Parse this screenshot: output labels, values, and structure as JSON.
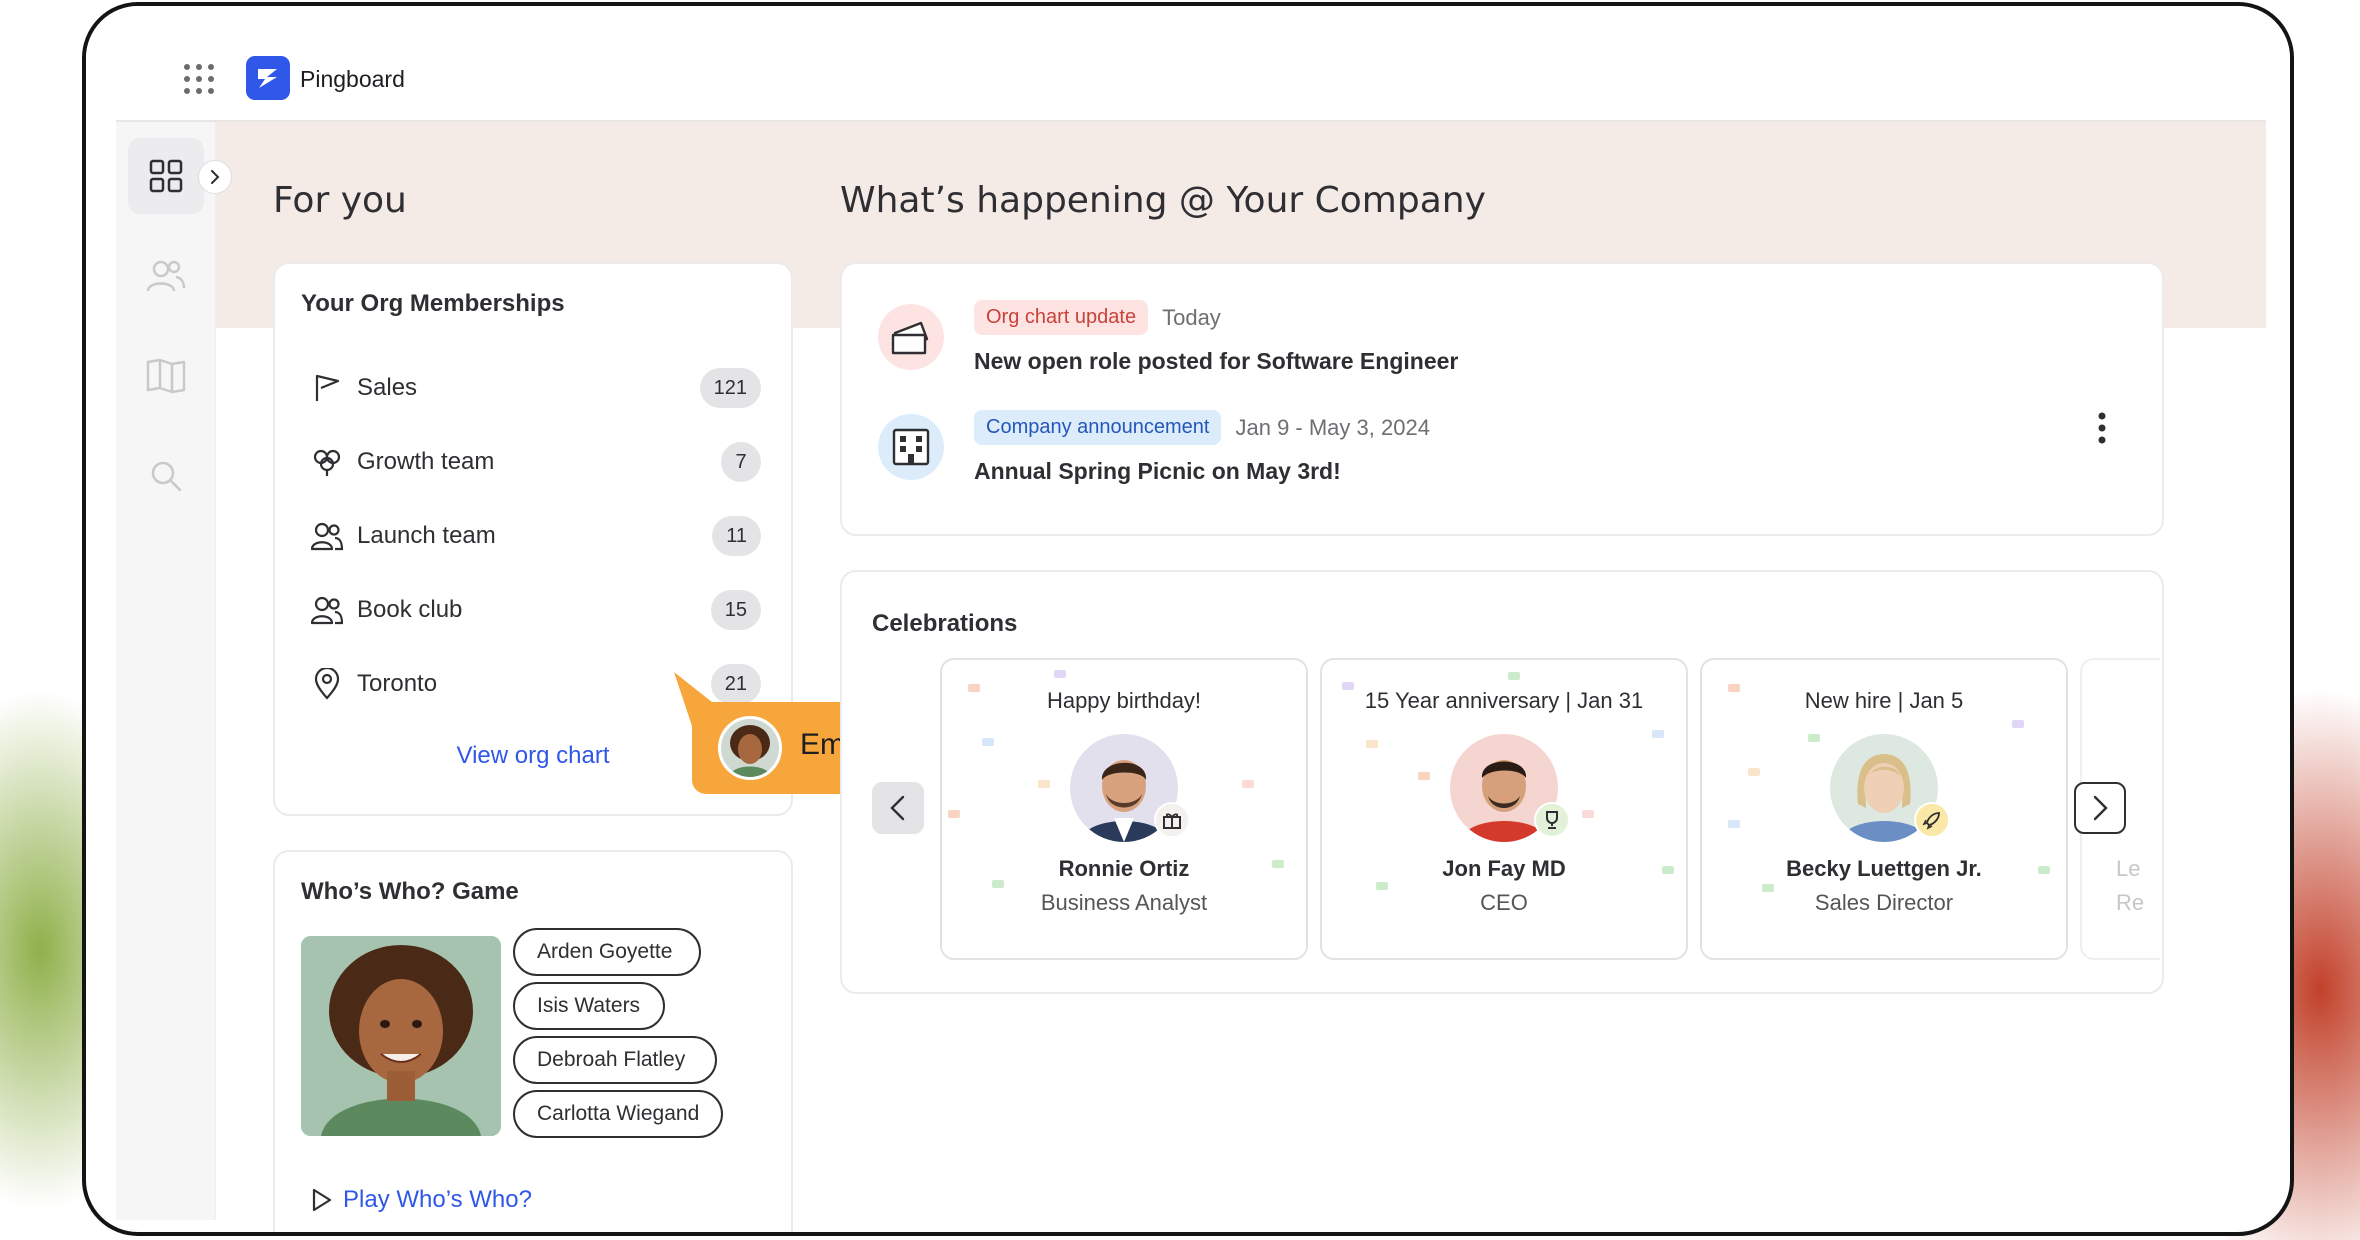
{
  "app": {
    "brand": "Pingboard"
  },
  "for_you": {
    "title": "For you",
    "memberships": {
      "title": "Your Org Memberships",
      "items": [
        {
          "label": "Sales",
          "count": "121",
          "icon": "flag-icon"
        },
        {
          "label": "Growth team",
          "count": "7",
          "icon": "flower-icon"
        },
        {
          "label": "Launch team",
          "count": "11",
          "icon": "users-icon"
        },
        {
          "label": "Book club",
          "count": "15",
          "icon": "users-icon"
        },
        {
          "label": "Toronto",
          "count": "21",
          "icon": "location-pin-icon"
        }
      ],
      "link": "View org chart"
    },
    "game": {
      "title": "Who’s Who? Game",
      "options": [
        "Arden Goyette",
        "Isis Waters",
        "Debroah Flatley",
        "Carlotta Wiegand"
      ],
      "play_label": "Play Who’s Who?",
      "tooltip": "Employee"
    }
  },
  "happening": {
    "title": "What’s happening @ Your Company",
    "feed": [
      {
        "tag": "Org chart update",
        "date": "Today",
        "text": "New open role posted for Software Engineer"
      },
      {
        "tag": "Company announcement",
        "date": "Jan 9 - May 3, 2024",
        "text": "Annual Spring Picnic on May 3rd!"
      }
    ]
  },
  "celebrations": {
    "title": "Celebrations",
    "cards": [
      {
        "head": "Happy birthday!",
        "name": "Ronnie Ortiz",
        "role": "Business Analyst",
        "badge": "gift-icon"
      },
      {
        "head": "15 Year anniversary | Jan 31",
        "name": "Jon Fay MD",
        "role": "CEO",
        "badge": "trophy-icon"
      },
      {
        "head": "New hire | Jan 5",
        "name": "Becky Luettgen Jr.",
        "role": "Sales Director",
        "badge": "rocket-icon"
      },
      {
        "head": "",
        "name": "Le",
        "role": "Re"
      }
    ]
  },
  "colors": {
    "accent": "#2f57e8",
    "tag_org_bg": "#fde4e2",
    "tag_org_text": "#c8423a",
    "tag_announce_bg": "#dcecfb",
    "tag_announce_text": "#2457b8",
    "tooltip": "#f7a63b"
  }
}
